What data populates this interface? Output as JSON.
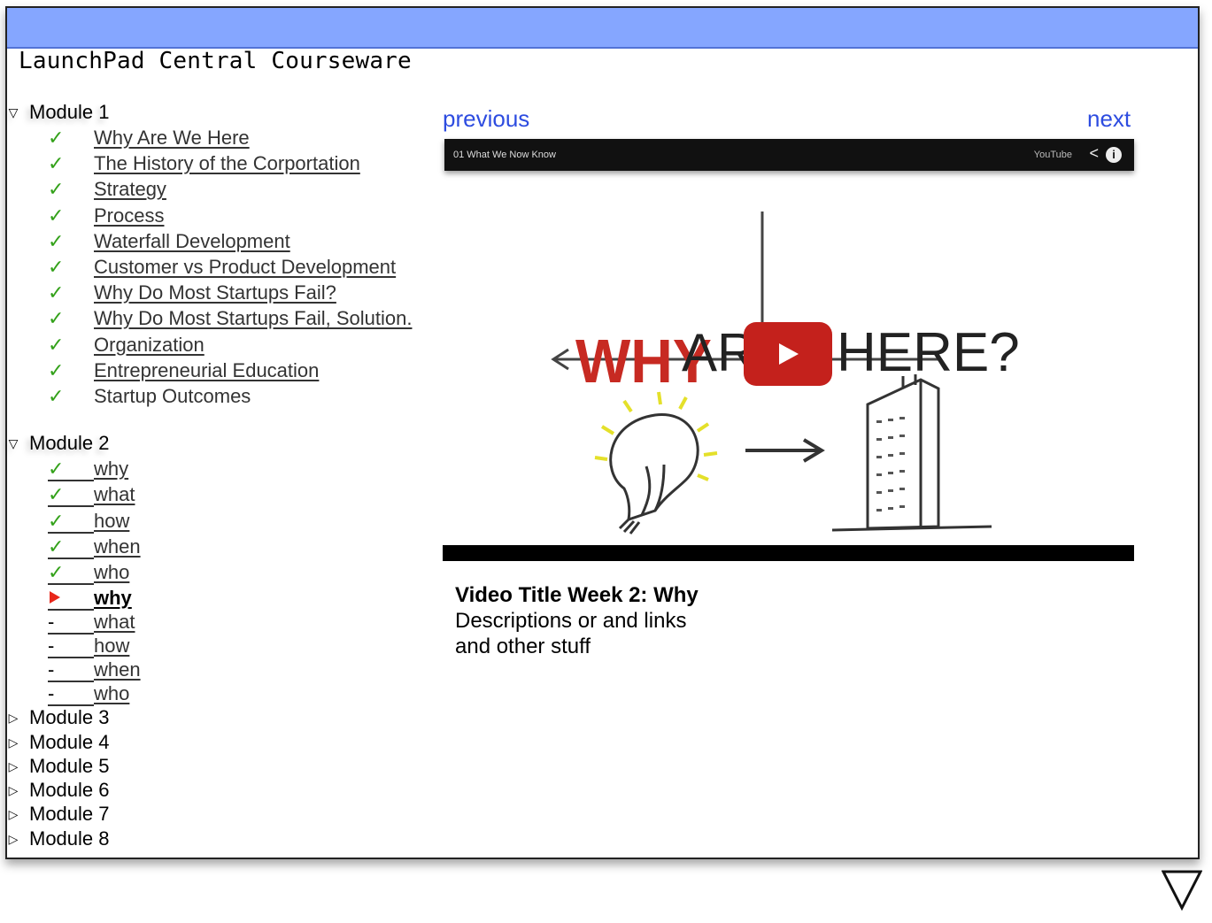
{
  "app": {
    "title": "LaunchPad Central Courseware"
  },
  "modules": [
    {
      "label": "Module 1",
      "expanded": true,
      "lessons": [
        {
          "label": "Why Are We Here",
          "status": "done"
        },
        {
          "label": "The History of the Corportation",
          "status": "done"
        },
        {
          "label": "Strategy",
          "status": "done"
        },
        {
          "label": "Process",
          "status": "done"
        },
        {
          "label": "Waterfall Development",
          "status": "done"
        },
        {
          "label": "Customer vs Product Development",
          "status": "done"
        },
        {
          "label": "Why Do Most Startups Fail?",
          "status": "done"
        },
        {
          "label": "Why Do Most Startups Fail, Solution.",
          "status": "done"
        },
        {
          "label": "Organization",
          "status": "done"
        },
        {
          "label": "Entrepreneurial Education",
          "status": "done"
        },
        {
          "label": "Startup Outcomes",
          "status": "done"
        }
      ]
    },
    {
      "label": "Module 2",
      "expanded": true,
      "lessons": [
        {
          "label": "why",
          "status": "done"
        },
        {
          "label": "what",
          "status": "done"
        },
        {
          "label": "how",
          "status": "done"
        },
        {
          "label": "when",
          "status": "done"
        },
        {
          "label": "who",
          "status": "done"
        },
        {
          "label": "why",
          "status": "current"
        },
        {
          "label": "what",
          "status": "pending"
        },
        {
          "label": "how",
          "status": "pending"
        },
        {
          "label": "when",
          "status": "pending"
        },
        {
          "label": "who",
          "status": "pending"
        }
      ]
    },
    {
      "label": "Module 3",
      "expanded": false
    },
    {
      "label": "Module 4",
      "expanded": false
    },
    {
      "label": "Module 5",
      "expanded": false
    },
    {
      "label": "Module 6",
      "expanded": false
    },
    {
      "label": "Module 7",
      "expanded": false
    },
    {
      "label": "Module 8",
      "expanded": false
    }
  ],
  "icons": {
    "expanded": "triangle-down-icon",
    "collapsed": "triangle-right-icon",
    "done": "checkmark-icon",
    "current": "current-arrow-icon",
    "pending": "dash-icon"
  },
  "glyphs": {
    "done": "✓",
    "pending": "-",
    "expanded": "▽",
    "collapsed": "▷"
  },
  "pager": {
    "previous": "previous",
    "next": "next"
  },
  "video": {
    "bar_title": "01 What We Now Know",
    "provider": "YouTube",
    "art_text": "WHY ARE WE HERE?"
  },
  "description": {
    "title": "Video Title Week 2: Why",
    "lines": [
      "Descriptions or and links",
      "and other stuff"
    ]
  },
  "colors": {
    "titlebar": "#85a6ff",
    "check": "#33a11a",
    "current": "#e8271b",
    "link": "#2d4ce0",
    "play_button": "#c4211c"
  }
}
